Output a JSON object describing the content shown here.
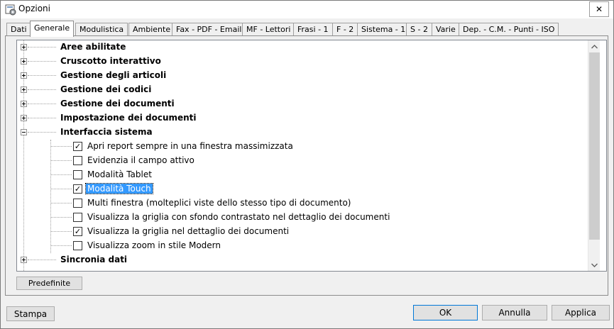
{
  "window": {
    "title": "Opzioni",
    "close_glyph": "✕"
  },
  "tabs": [
    {
      "label": "Dati"
    },
    {
      "label": "Generale"
    },
    {
      "label": "Modulistica"
    },
    {
      "label": "Ambiente"
    },
    {
      "label": "Fax - PDF - Email"
    },
    {
      "label": "MF - Lettori"
    },
    {
      "label": "Frasi - 1"
    },
    {
      "label": "F - 2"
    },
    {
      "label": "Sistema - 1"
    },
    {
      "label": "S - 2"
    },
    {
      "label": "Varie"
    },
    {
      "label": "Dep. - C.M. - Punti - ISO"
    }
  ],
  "active_tab": "Generale",
  "tree": {
    "groups": [
      {
        "label": "Aree abilitate",
        "expanded": false
      },
      {
        "label": "Cruscotto interattivo",
        "expanded": false
      },
      {
        "label": "Gestione degli articoli",
        "expanded": false
      },
      {
        "label": "Gestione dei codici",
        "expanded": false
      },
      {
        "label": "Gestione dei documenti",
        "expanded": false
      },
      {
        "label": "Impostazione dei documenti",
        "expanded": false
      },
      {
        "label": "Interfaccia sistema",
        "expanded": true
      },
      {
        "label": "Sincronia dati",
        "expanded": false
      }
    ],
    "options": [
      {
        "label": "Apri report sempre in una finestra massimizzata",
        "checked": true
      },
      {
        "label": "Evidenzia il campo attivo",
        "checked": false
      },
      {
        "label": "Modalità Tablet",
        "checked": false
      },
      {
        "label": "Modalità Touch",
        "checked": true,
        "selected": true
      },
      {
        "label": "Multi finestra (molteplici viste dello stesso tipo di documento)",
        "checked": false
      },
      {
        "label": "Visualizza la griglia con sfondo contrastato nel dettaglio dei documenti",
        "checked": false
      },
      {
        "label": "Visualizza la griglia nel dettaglio dei documenti",
        "checked": true
      },
      {
        "label": "Visualizza zoom in stile Modern",
        "checked": false
      }
    ],
    "check_glyph": "✓"
  },
  "buttons": {
    "predefinite": "Predefinite",
    "stampa": "Stampa",
    "ok": "OK",
    "annulla": "Annulla",
    "applica": "Applica"
  },
  "colors": {
    "selection": "#3399ff",
    "default_button_border": "#0078d7"
  },
  "icons": {
    "title": "options-window-icon",
    "close": "close-icon",
    "expand": "plus-expander-icon",
    "collapse": "minus-expander-icon",
    "scroll_up": "scroll-up-arrow-icon",
    "scroll_down": "scroll-down-arrow-icon"
  }
}
